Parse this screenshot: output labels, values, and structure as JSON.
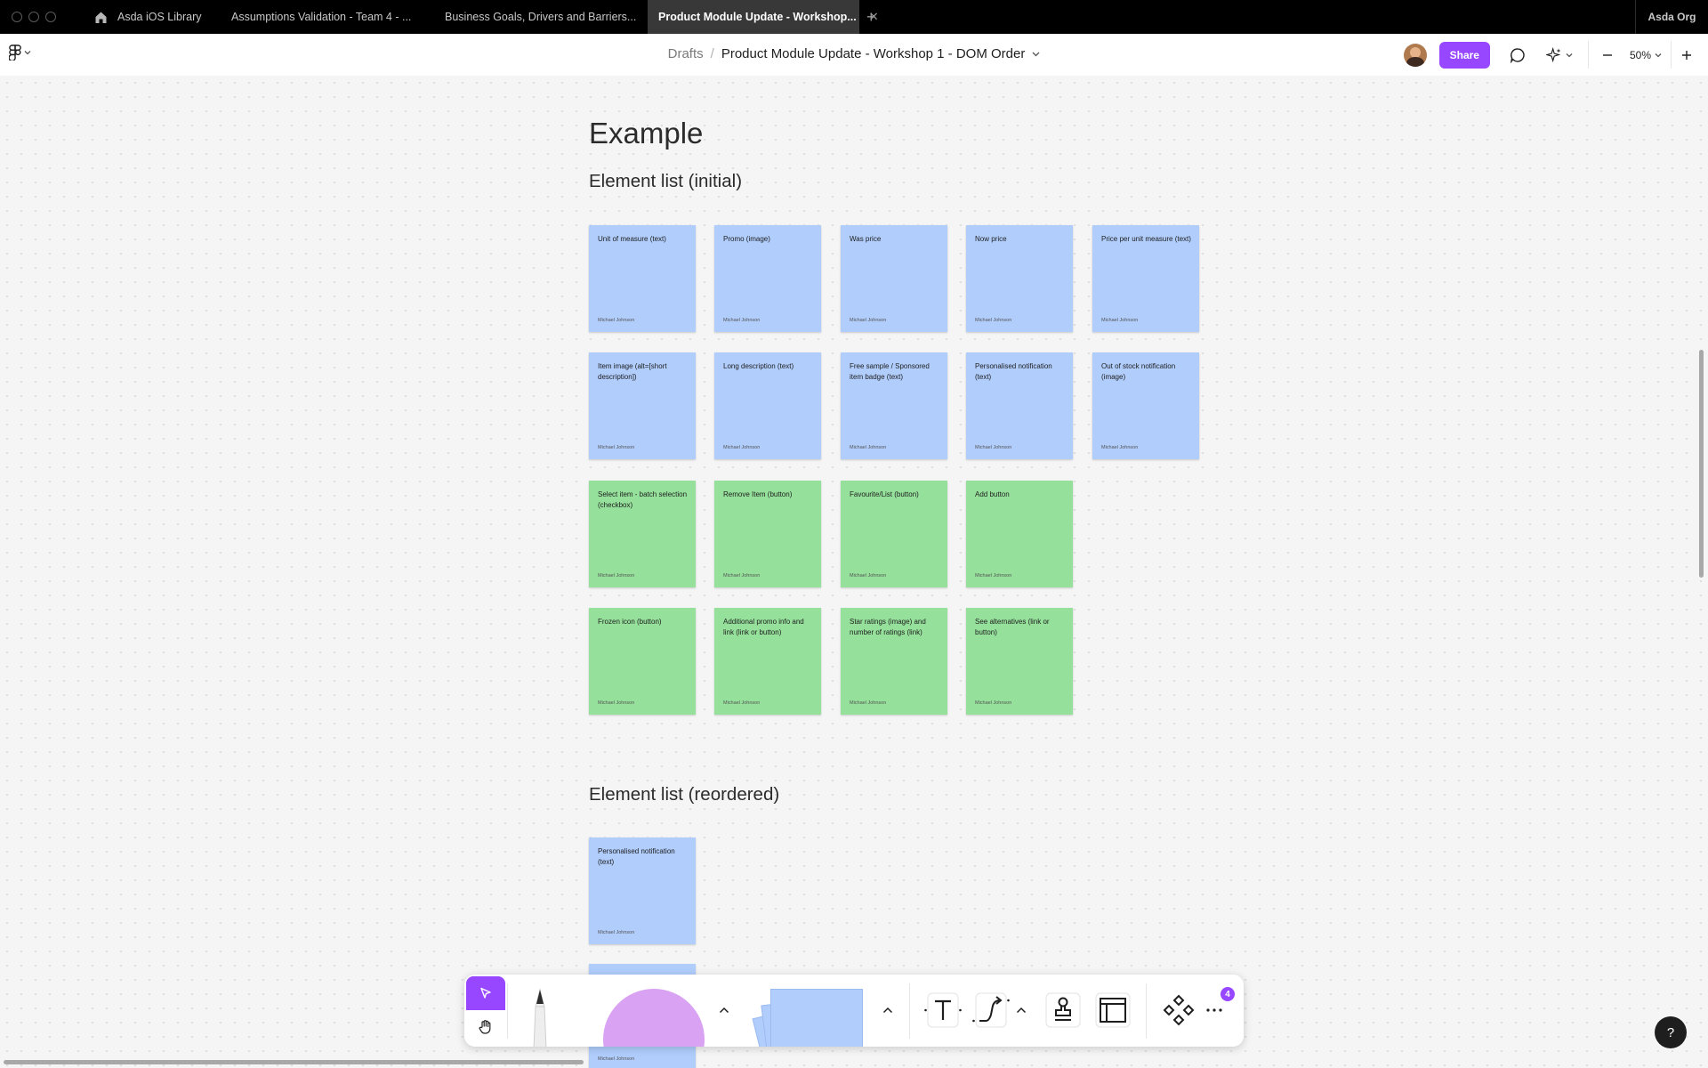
{
  "tabs": {
    "items": [
      {
        "label": "Asda iOS Library"
      },
      {
        "label": "Assumptions Validation - Team 4 - ..."
      },
      {
        "label": "Business Goals, Drivers and Barriers..."
      },
      {
        "label": "Product Module Update - Workshop..."
      }
    ],
    "close_glyph": "✕",
    "new_tab_glyph": "+",
    "org_label": "Asda Org"
  },
  "toolbar": {
    "breadcrumb_parent": "Drafts",
    "breadcrumb_separator": "/",
    "file_title": "Product Module Update - Workshop 1 - DOM Order",
    "share_label": "Share",
    "zoom_label": "50%"
  },
  "canvas": {
    "heading": "Example",
    "section_initial": "Element list (initial)",
    "section_reordered": "Element list (reordered)",
    "stickies": [
      {
        "text": "Unit of measure (text)",
        "author": "Michael Johnson",
        "color": "blue"
      },
      {
        "text": "Promo (image)",
        "author": "Michael Johnson",
        "color": "blue"
      },
      {
        "text": "Was price",
        "author": "Michael Johnson",
        "color": "blue"
      },
      {
        "text": "Now price",
        "author": "Michael Johnson",
        "color": "blue"
      },
      {
        "text": "Price per unit measure (text)",
        "author": "Michael Johnson",
        "color": "blue"
      },
      {
        "text": "Item image (alt=[short description])",
        "author": "Michael Johnson",
        "color": "blue"
      },
      {
        "text": "Long description (text)",
        "author": "Michael Johnson",
        "color": "blue"
      },
      {
        "text": "Free sample / Sponsored item badge (text)",
        "author": "Michael Johnson",
        "color": "blue"
      },
      {
        "text": "Personalised notification (text)",
        "author": "Michael Johnson",
        "color": "blue"
      },
      {
        "text": "Out of stock notification (image)",
        "author": "Michael Johnson",
        "color": "blue"
      },
      {
        "text": "Select item - batch selection (checkbox)",
        "author": "Michael Johnson",
        "color": "green"
      },
      {
        "text": "Remove Item (button)",
        "author": "Michael Johnson",
        "color": "green"
      },
      {
        "text": "Favourite/List (button)",
        "author": "Michael Johnson",
        "color": "green"
      },
      {
        "text": "Add button",
        "author": "Michael Johnson",
        "color": "green"
      },
      {
        "text": "Frozen icon (button)",
        "author": "Michael Johnson",
        "color": "green"
      },
      {
        "text": "Additional promo info and link (link or button)",
        "author": "Michael Johnson",
        "color": "green"
      },
      {
        "text": "Star ratings (image) and number of ratings (link)",
        "author": "Michael Johnson",
        "color": "green"
      },
      {
        "text": "See alternatives (link or button)",
        "author": "Michael Johnson",
        "color": "green"
      }
    ],
    "reordered_stickies": [
      {
        "text": "Personalised notification (text)",
        "author": "Michael Johnson",
        "color": "blue"
      },
      {
        "text": "",
        "author": "Michael Johnson",
        "color": "blue"
      }
    ]
  },
  "dock": {
    "tools": [
      "move-tool",
      "hand-tool",
      "pen-tool",
      "shape-tool",
      "sticky-tool",
      "text-tool",
      "connector-tool",
      "stamp-tool",
      "section-tool",
      "components-tool",
      "more-tool"
    ],
    "badge_count": "4"
  },
  "help_label": "?",
  "colors": {
    "accent": "#9747ff",
    "sticky_blue": "#b0cdfc",
    "sticky_green": "#95e09b",
    "shape_violet": "#d9a2f3"
  }
}
